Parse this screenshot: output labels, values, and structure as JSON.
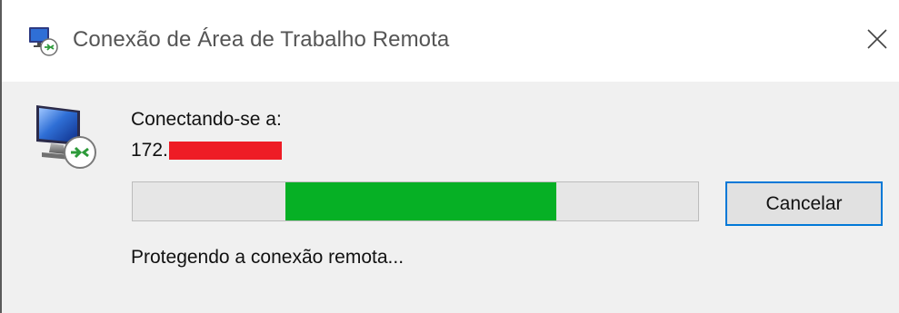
{
  "window": {
    "title": "Conexão de Área de Trabalho Remota",
    "title_icon": "remote-desktop-icon",
    "close_icon": "close-icon"
  },
  "dialog": {
    "main_icon": "remote-desktop-monitor-icon",
    "connecting_label": "Conectando-se a:",
    "address_prefix": "172.",
    "address_redacted": true,
    "redaction_color": "#ee1c25",
    "progress": {
      "style": "marquee",
      "fill_start": 0.27,
      "fill_end": 0.75,
      "fill_color": "#06b025",
      "track_color": "#e6e6e6"
    },
    "cancel_label": "Cancelar",
    "status": "Protegendo a conexão remota..."
  },
  "colors": {
    "accent": "#0078d7",
    "background": "#f0f0f0",
    "titlebar": "#ffffff"
  }
}
